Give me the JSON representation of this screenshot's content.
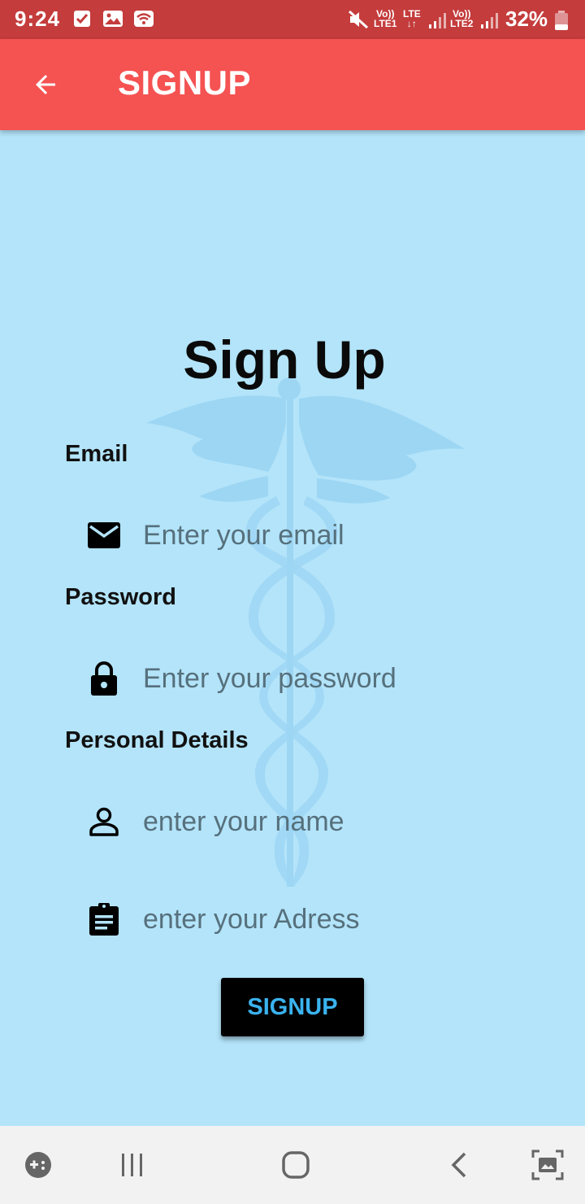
{
  "status_bar": {
    "time": "9:24",
    "battery_percent": "32%",
    "sim1_label_top": "Vo))",
    "sim1_label_bottom": "LTE1",
    "lte_label_top": "LTE",
    "lte_label_bottom": "↓↑",
    "sim2_label_top": "Vo))",
    "sim2_label_bottom": "LTE2",
    "icons": [
      "check-box-icon",
      "image-icon",
      "wifi-icon",
      "mute-icon",
      "signal-icon",
      "battery-icon"
    ]
  },
  "app_bar": {
    "title": "SIGNUP",
    "back_icon": "arrow-back-icon",
    "color": "#f55252"
  },
  "main": {
    "heading": "Sign Up",
    "email_label": "Email",
    "email_placeholder": "Enter your email",
    "password_label": "Password",
    "password_placeholder": "Enter your password",
    "personal_label": "Personal Details",
    "name_placeholder": "enter your name",
    "address_placeholder": "enter your Adress",
    "signup_button": "SIGNUP",
    "background_color": "#b3e4fa"
  },
  "nav_bar": {
    "items": [
      "game-launcher-icon",
      "recent-apps-icon",
      "home-icon",
      "back-icon",
      "screenshot-icon"
    ]
  }
}
